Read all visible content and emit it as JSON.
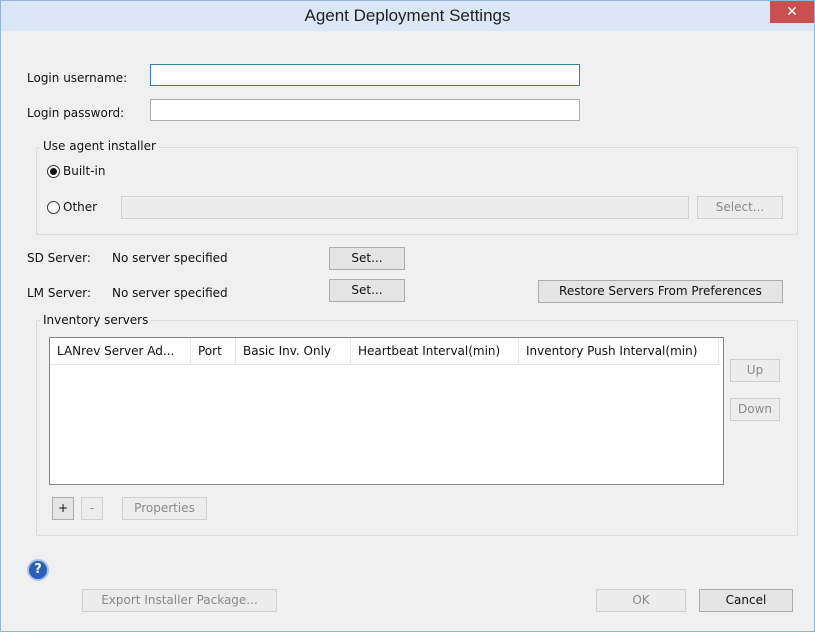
{
  "window": {
    "title": "Agent Deployment Settings",
    "close_glyph": "✕"
  },
  "login": {
    "username_label": "Login username:",
    "username_value": "",
    "password_label": "Login password:",
    "password_value": ""
  },
  "installer": {
    "group_label": "Use agent installer",
    "builtin_label": "Built-in",
    "other_label": "Other",
    "selected": "Built-in",
    "other_path_value": "",
    "select_button": "Select..."
  },
  "servers": {
    "sd_label": "SD Server:",
    "sd_value": "No server specified",
    "sd_set_button": "Set...",
    "lm_label": "LM Server:",
    "lm_value": "No server specified",
    "lm_set_button": "Set...",
    "restore_button": "Restore Servers From Preferences"
  },
  "inventory": {
    "group_label": "Inventory servers",
    "columns": [
      "LANrev Server Ad...",
      "Port",
      "Basic Inv. Only",
      "Heartbeat Interval(min)",
      "Inventory Push Interval(min)"
    ],
    "rows": [],
    "up_button": "Up",
    "down_button": "Down",
    "add_button": "+",
    "remove_button": "-",
    "properties_button": "Properties"
  },
  "footer": {
    "help_icon": "question-mark-icon",
    "help_glyph": "?",
    "export_button": "Export Installer Package...",
    "ok_button": "OK",
    "cancel_button": "Cancel"
  },
  "colors": {
    "close_button": "#c75050",
    "titlebar": "#dbe7f5",
    "focus_border": "#3c7fb1",
    "help_icon": "#2d5fb8"
  }
}
